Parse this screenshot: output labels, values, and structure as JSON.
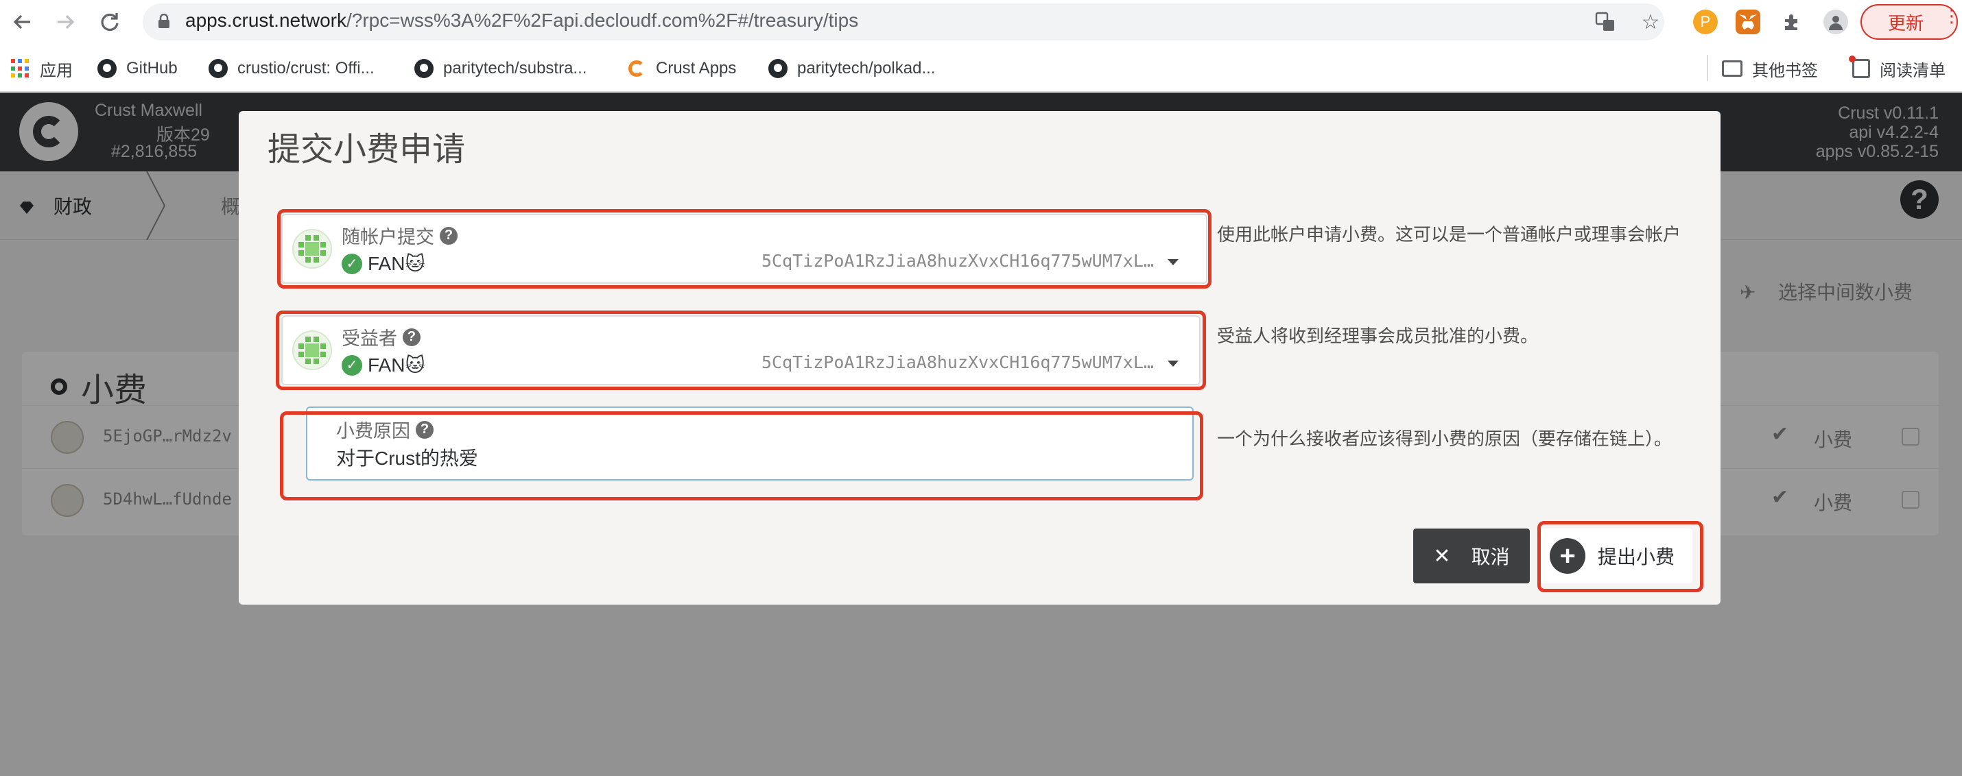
{
  "browser": {
    "url_host": "apps.crust.network",
    "url_rest": "/?rpc=wss%3A%2F%2Fapi.decloudf.com%2F#/treasury/tips",
    "update_label": "更新",
    "bookmarks": [
      {
        "label": "应用"
      },
      {
        "label": "GitHub"
      },
      {
        "label": "crustio/crust: Offi..."
      },
      {
        "label": "paritytech/substra..."
      },
      {
        "label": "Crust Apps"
      },
      {
        "label": "paritytech/polkad..."
      }
    ],
    "other_bookmarks": "其他书签",
    "reading_list": "阅读清单"
  },
  "header": {
    "chain_name": "Crust Maxwell",
    "chain_version": "版本29",
    "block_number": "#2,816,855",
    "versions": [
      "Crust v0.11.1",
      "api v4.2.2-4",
      "apps v0.85.2-15"
    ]
  },
  "subnav": {
    "finance_tab": "财政",
    "overview_tab": "概"
  },
  "page": {
    "median_button": "选择中间数小费",
    "tips_title": "小费",
    "tips": [
      {
        "address": "5EjoGP…rMdz2v",
        "status": "小费"
      },
      {
        "address": "5D4hwL…fUdnde",
        "status": "小费"
      }
    ]
  },
  "modal": {
    "title": "提交小费申请",
    "submitter": {
      "label": "随帐户提交",
      "account_name": "FAN🐱",
      "account_address": "5CqTizPoA1RzJiaA8huzXvxCH16q775wUM7xL…",
      "help": "使用此帐户申请小费。这可以是一个普通帐户或理事会帐户"
    },
    "beneficiary": {
      "label": "受益者",
      "account_name": "FAN🐱",
      "account_address": "5CqTizPoA1RzJiaA8huzXvxCH16q775wUM7xL…",
      "help": "受益人将收到经理事会成员批准的小费。"
    },
    "reason": {
      "label": "小费原因",
      "value": "对于Crust的热爱",
      "help": "一个为什么接收者应该得到小费的原因（要存储在链上）。"
    },
    "cancel_label": "取消",
    "submit_label": "提出小费"
  },
  "colors": {
    "highlight": "#e03a24",
    "header_bg": "#3d3f41",
    "verified": "#48a254"
  }
}
